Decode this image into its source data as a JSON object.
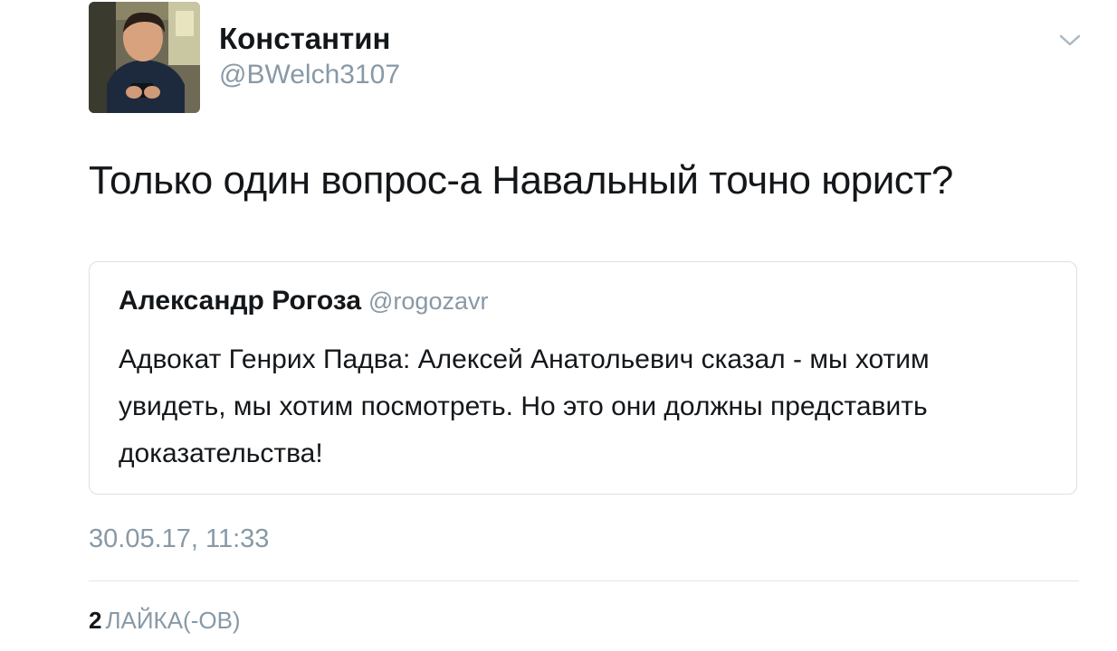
{
  "tweet": {
    "author": {
      "name": "Константин",
      "handle": "@BWelch3107"
    },
    "menu_icon": "chevron-down-icon",
    "text": "Только один вопрос-а Навальный точно юрист?",
    "quoted": {
      "name": "Александр Рогоза",
      "handle": "@rogozavr",
      "text": "Адвокат Генрих Падва: Алексей Анатольевич сказал - мы хотим увидеть, мы хотим посмотреть. Но это они должны представить доказательства!"
    },
    "timestamp": "30.05.17, 11:33",
    "likes": {
      "count": "2",
      "label": "ЛАЙКА(-ОВ)"
    }
  },
  "colors": {
    "primary_text": "#14171a",
    "secondary_text": "#8899a6",
    "border": "#d9e1e8"
  }
}
